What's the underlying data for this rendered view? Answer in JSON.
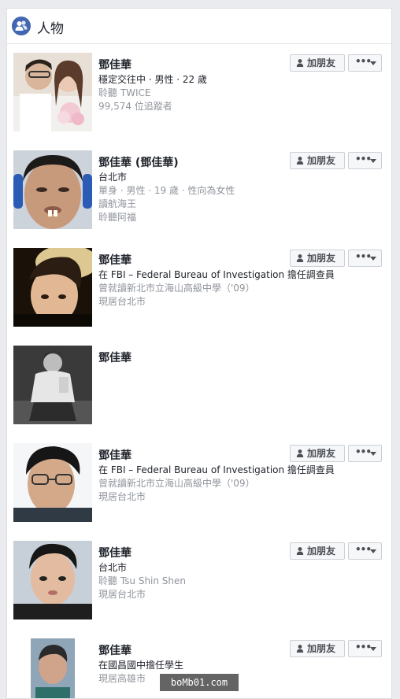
{
  "section": {
    "title": "人物",
    "icon": "people-icon"
  },
  "accent_color": "#4267b2",
  "people": [
    {
      "name": "鄧佳華",
      "details": [
        {
          "text": "穩定交往中 · 男性 · 22 歲",
          "tone": "dark"
        },
        {
          "text": "聆聽 TWICE",
          "tone": "grey"
        },
        {
          "text": "99,574 位追蹤者",
          "tone": "grey"
        }
      ],
      "add_label": "加朋友",
      "has_buttons": true
    },
    {
      "name": "鄧佳華 (鄧佳華)",
      "details": [
        {
          "text": "台北市",
          "tone": "dark"
        },
        {
          "text": "單身 · 男性 · 19 歲 · 性向為女性",
          "tone": "grey"
        },
        {
          "text": "讀航海王",
          "tone": "grey"
        },
        {
          "text": "聆聽阿福",
          "tone": "grey"
        }
      ],
      "add_label": "加朋友",
      "has_buttons": true
    },
    {
      "name": "鄧佳華",
      "details": [
        {
          "text": "在 FBI – Federal Bureau of Investigation 擔任調查員",
          "tone": "dark"
        },
        {
          "text": "曾就讀新北市立海山高級中學（'09）",
          "tone": "grey"
        },
        {
          "text": "現居台北市",
          "tone": "grey"
        }
      ],
      "add_label": "加朋友",
      "has_buttons": true
    },
    {
      "name": "鄧佳華",
      "details": [],
      "add_label": "",
      "has_buttons": false
    },
    {
      "name": "鄧佳華",
      "details": [
        {
          "text": "在 FBI – Federal Bureau of Investigation 擔任調查員",
          "tone": "dark"
        },
        {
          "text": "曾就讀新北市立海山高級中學（'09）",
          "tone": "grey"
        },
        {
          "text": "現居台北市",
          "tone": "grey"
        }
      ],
      "add_label": "加朋友",
      "has_buttons": true
    },
    {
      "name": "鄧佳華",
      "details": [
        {
          "text": "台北市",
          "tone": "dark"
        },
        {
          "text": "聆聽 Tsu Shin Shen",
          "tone": "grey"
        },
        {
          "text": "現居台北市",
          "tone": "grey"
        }
      ],
      "add_label": "加朋友",
      "has_buttons": true
    },
    {
      "name": "鄧佳華",
      "details": [
        {
          "text": "在國昌國中擔任學生",
          "tone": "dark"
        },
        {
          "text": "現居高雄市",
          "tone": "grey"
        }
      ],
      "add_label": "加朋友",
      "has_buttons": true
    }
  ],
  "watermark": "boMb01.com"
}
